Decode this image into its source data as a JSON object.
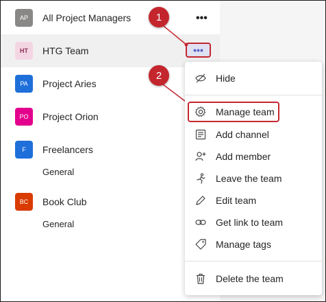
{
  "colors": {
    "accent": "#5b5fc7",
    "callout": "#c4262e",
    "text": "#252423"
  },
  "teams": [
    {
      "id": "all-pm",
      "initials": "AP",
      "name": "All Project Managers",
      "avatar_color": "#8a8886"
    },
    {
      "id": "htg",
      "initials": "HT",
      "name": "HTG Team",
      "avatar_color": "#f4d6e3"
    },
    {
      "id": "aries",
      "initials": "PA",
      "name": "Project Aries",
      "avatar_color": "#1e6fd9"
    },
    {
      "id": "orion",
      "initials": "PO",
      "name": "Project Orion",
      "avatar_color": "#e3008c"
    },
    {
      "id": "freelancers",
      "initials": "F",
      "name": "Freelancers",
      "avatar_color": "#1e6fd9",
      "channel": "General"
    },
    {
      "id": "bookclub",
      "initials": "BC",
      "name": "Book Club",
      "avatar_color": "#da3b01",
      "channel": "General"
    }
  ],
  "more_options": {
    "glyph": "•••"
  },
  "callouts": {
    "one": "1",
    "two": "2"
  },
  "context_menu": {
    "items": [
      {
        "label": "Hide",
        "icon": "hide-icon"
      },
      {
        "label": "Manage team",
        "icon": "gear-icon"
      },
      {
        "label": "Add channel",
        "icon": "channel-icon"
      },
      {
        "label": "Add member",
        "icon": "add-member-icon"
      },
      {
        "label": "Leave the team",
        "icon": "leave-icon"
      },
      {
        "label": "Edit team",
        "icon": "pencil-icon"
      },
      {
        "label": "Get link to team",
        "icon": "link-icon"
      },
      {
        "label": "Manage tags",
        "icon": "tag-icon"
      },
      {
        "label": "Delete the team",
        "icon": "trash-icon"
      }
    ]
  }
}
